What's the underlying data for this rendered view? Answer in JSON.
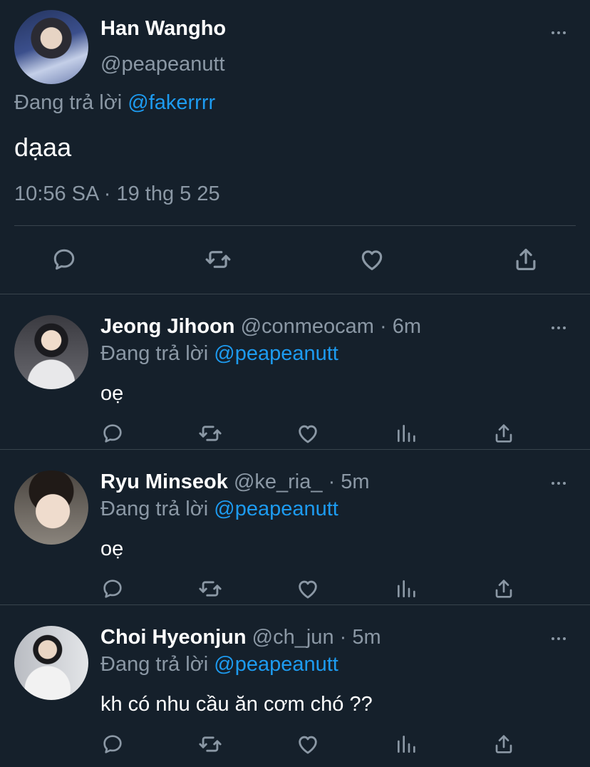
{
  "main_tweet": {
    "name": "Han Wangho",
    "handle": "@peapeanutt",
    "replying_prefix": "Đang trả lời",
    "replying_to": "@fakerrrr",
    "text": "dạaa",
    "timestamp": "10:56 SA · 19 thg 5 25",
    "avatar_colors": [
      "#1c2a4a",
      "#a9b6d8"
    ]
  },
  "replies": [
    {
      "name": "Jeong Jihoon",
      "handle": "@conmeocam",
      "time": "· 6m",
      "replying_prefix": "Đang trả lời",
      "replying_to": "@peapeanutt",
      "text": "oẹ"
    },
    {
      "name": "Ryu Minseok",
      "handle": "@ke_ria_",
      "time": "· 5m",
      "replying_prefix": "Đang trả lời",
      "replying_to": "@peapeanutt",
      "text": "oẹ"
    },
    {
      "name": "Choi Hyeonjun",
      "handle": "@ch_jun",
      "time": "· 5m",
      "replying_prefix": "Đang trả lời",
      "replying_to": "@peapeanutt",
      "text": "kh có nhu cầu ăn cơm chó ??"
    }
  ],
  "icons": {
    "reply": "reply-icon",
    "retweet": "retweet-icon",
    "like": "heart-icon",
    "views": "views-icon",
    "share": "share-icon",
    "more": "more-icon"
  },
  "colors": {
    "background": "#15202b",
    "accent": "#1d9bf0",
    "muted": "#8b98a5",
    "divider": "#38444d"
  }
}
